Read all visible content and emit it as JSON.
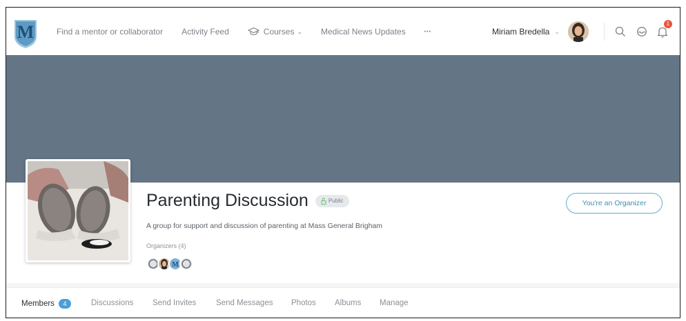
{
  "nav": {
    "logo_letter": "M",
    "links": {
      "find": "Find a mentor or collaborator",
      "activity": "Activity Feed",
      "courses": "Courses",
      "news": "Medical News Updates",
      "more": "•••"
    },
    "user_name": "Miriam Bredella",
    "notification_count": "1"
  },
  "group": {
    "title": "Parenting Discussion",
    "privacy": "Public",
    "description": "A group for support and discussion of parenting at Mass General Brigham",
    "organizers_label": "Organizers (4)",
    "role_button": "You're an Organizer"
  },
  "tabs": {
    "members": "Members",
    "members_count": "4",
    "discussions": "Discussions",
    "invites": "Send Invites",
    "messages": "Send Messages",
    "photos": "Photos",
    "albums": "Albums",
    "manage": "Manage"
  },
  "colors": {
    "cover": "#647586",
    "accent": "#4a9fd8",
    "badge": "#e8553e"
  }
}
